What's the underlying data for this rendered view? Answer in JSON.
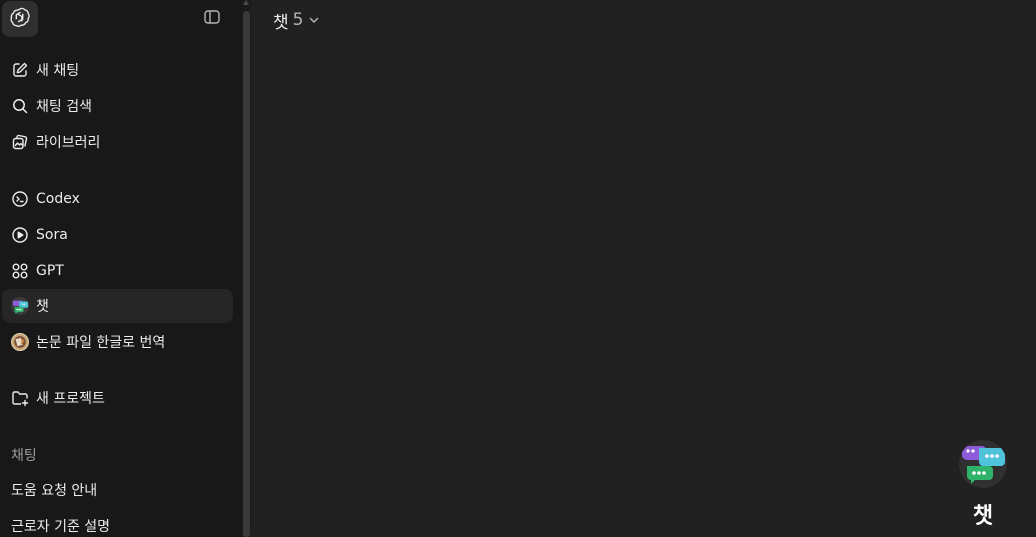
{
  "sidebar": {
    "logo": "openai-logo-icon",
    "toggle": "sidebar-toggle-icon",
    "nav": [
      {
        "label": "새 채팅",
        "icon": "edit-icon"
      },
      {
        "label": "채팅 검색",
        "icon": "search-icon"
      },
      {
        "label": "라이브러리",
        "icon": "library-icon"
      }
    ],
    "apps": [
      {
        "label": "Codex",
        "icon": "codex-icon"
      },
      {
        "label": "Sora",
        "icon": "sora-play-icon"
      },
      {
        "label": "GPT",
        "icon": "gpt-grid-icon"
      }
    ],
    "gpts": [
      {
        "label": "챗",
        "icon": "chat-bubbles-avatar-icon"
      },
      {
        "label": "논문 파일 한글로 번역",
        "icon": "paper-translator-avatar-icon"
      }
    ],
    "project": {
      "label": "새 프로젝트",
      "icon": "folder-plus-icon"
    },
    "chats_section": "채팅",
    "chats": [
      {
        "label": "도움 요청 안내"
      },
      {
        "label": "근로자 기준 설명"
      }
    ]
  },
  "header": {
    "model_name": "챗",
    "model_version": "5",
    "chevron": "chevron-down-icon"
  },
  "main": {
    "gpt_title": "챗",
    "gpt_avatar": "chat-bubbles-avatar-icon"
  },
  "colors": {
    "sidebar_bg": "#181818",
    "main_bg": "#212121",
    "active_item_bg": "#262626",
    "text": "#ececec",
    "muted_text": "#9b9b9b"
  }
}
